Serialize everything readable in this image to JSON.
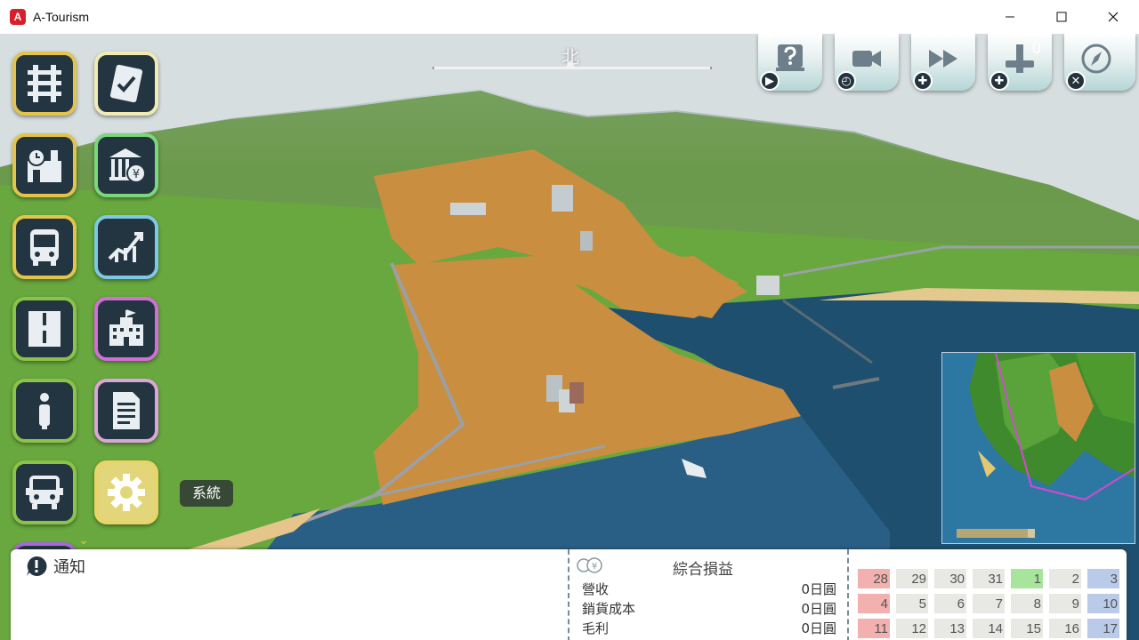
{
  "window": {
    "title": "A-Tourism",
    "icon_letter": "A",
    "controls": [
      "minimize",
      "maximize",
      "close"
    ]
  },
  "compass": {
    "label": "北"
  },
  "toolbar": {
    "buttons": [
      {
        "name": "help",
        "icon": "question-book-icon",
        "badge": "play"
      },
      {
        "name": "camera",
        "icon": "video-camera-icon",
        "badge": "clock"
      },
      {
        "name": "speed",
        "icon": "fast-forward-icon",
        "badge": "plus"
      },
      {
        "name": "build",
        "icon": "signal-icon",
        "badge": "plus",
        "count": "0"
      },
      {
        "name": "compass",
        "icon": "compass-icon",
        "badge": "x"
      }
    ]
  },
  "sidebar": {
    "left": [
      {
        "name": "track",
        "icon": "railway-track-icon",
        "border": "#e4c34a"
      },
      {
        "name": "station",
        "icon": "station-clock-icon",
        "border": "#e4c34a"
      },
      {
        "name": "bus",
        "icon": "bus-icon",
        "border": "#e4c34a"
      },
      {
        "name": "road",
        "icon": "road-icon",
        "border": "#8bc34a"
      },
      {
        "name": "info",
        "icon": "info-icon",
        "border": "#8bc34a"
      },
      {
        "name": "truck",
        "icon": "truck-icon",
        "border": "#8bc34a"
      }
    ],
    "right": [
      {
        "name": "tasks",
        "icon": "checklist-icon",
        "border": "#f0ebb3"
      },
      {
        "name": "bank",
        "icon": "bank-yen-icon",
        "border": "#7bd77b"
      },
      {
        "name": "stocks",
        "icon": "stock-chart-icon",
        "border": "#7ec8e3"
      },
      {
        "name": "buildings",
        "icon": "building-icon",
        "border": "#d16fd6"
      },
      {
        "name": "reports",
        "icon": "document-icon",
        "border": "#d9a6d6"
      },
      {
        "name": "system",
        "icon": "gear-icon",
        "border": "#e9d566",
        "active": true
      }
    ],
    "tooltip": "系統"
  },
  "notification": {
    "title": "通知"
  },
  "pnl": {
    "title": "綜合損益",
    "rows": [
      {
        "label": "營收",
        "value": "0日圓"
      },
      {
        "label": "銷貨成本",
        "value": "0日圓"
      },
      {
        "label": "毛利",
        "value": "0日圓"
      }
    ]
  },
  "calendar": {
    "rows": [
      [
        "28",
        "29",
        "30",
        "31",
        "1",
        "2",
        "3"
      ],
      [
        "4",
        "5",
        "6",
        "7",
        "8",
        "9",
        "10"
      ],
      [
        "11",
        "12",
        "13",
        "14",
        "15",
        "16",
        "17"
      ]
    ],
    "colors": {
      "sunday": "#f2b0ae",
      "weekday": "#e8e8e4",
      "saturday": "#b9cbe8",
      "today": "#a7e59c"
    }
  }
}
